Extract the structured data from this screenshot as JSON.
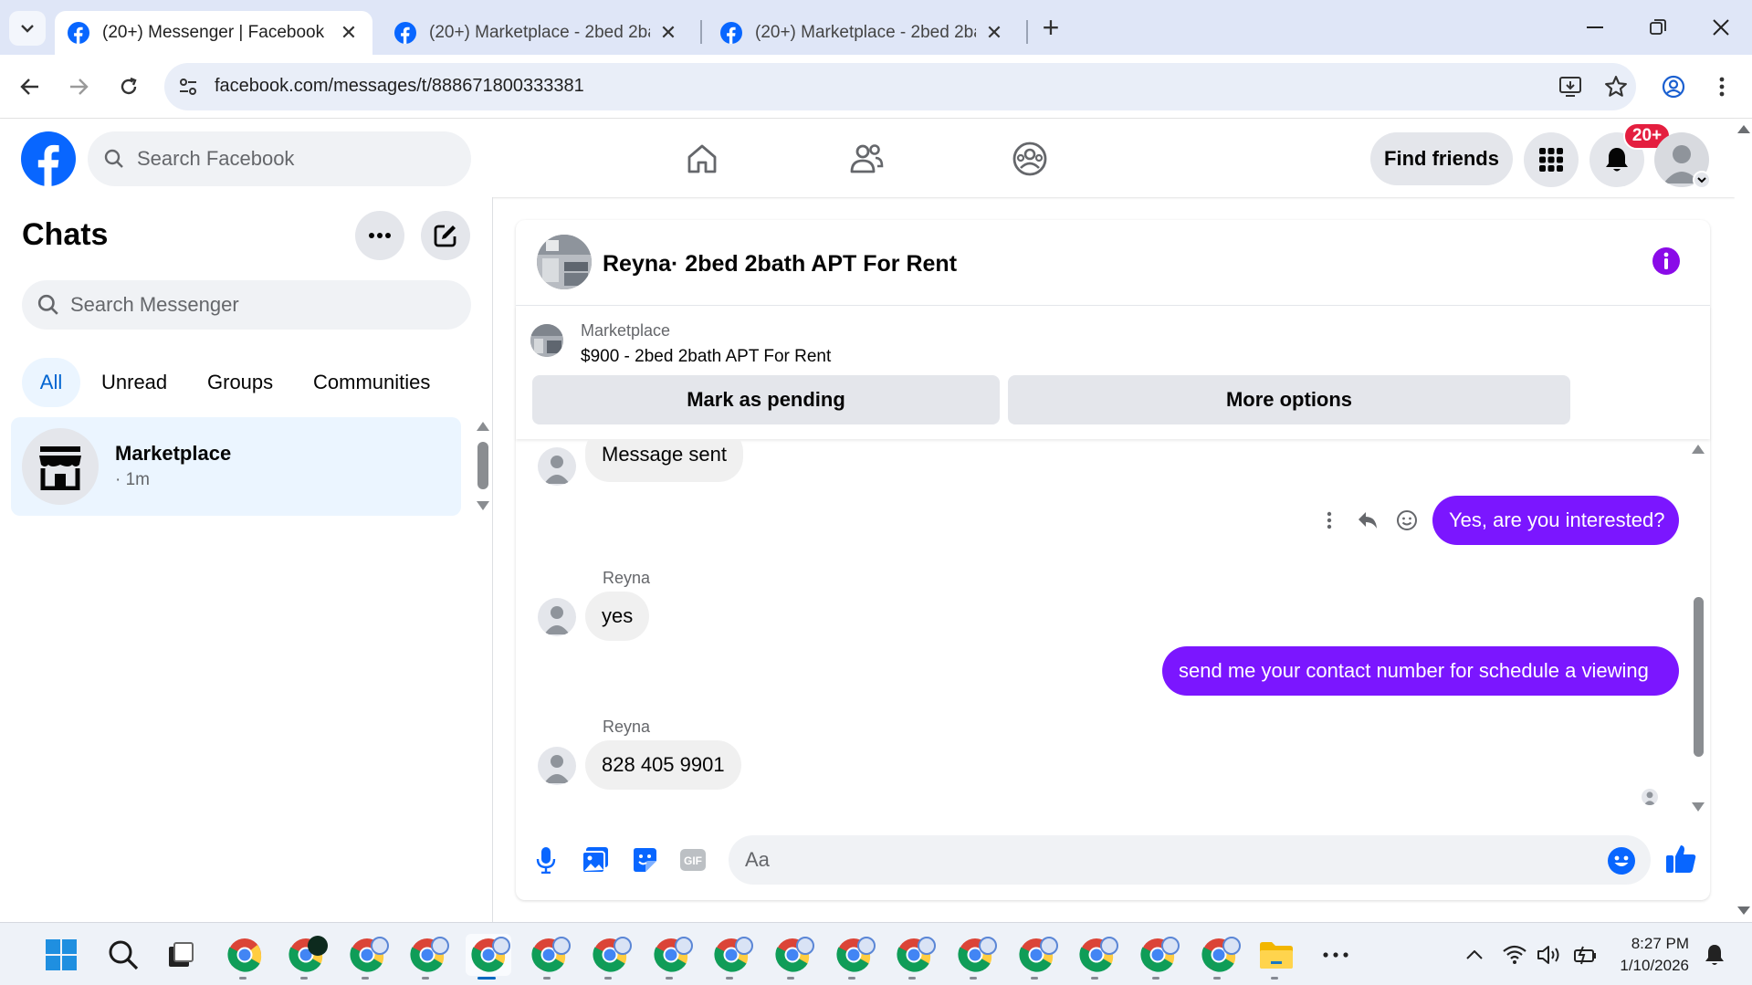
{
  "browser": {
    "tabs": [
      {
        "title": "(20+) Messenger | Facebook",
        "active": true
      },
      {
        "title": "(20+) Marketplace - 2bed 2bath",
        "active": false
      },
      {
        "title": "(20+) Marketplace - 2bed 2bath",
        "active": false
      }
    ],
    "url": "facebook.com/messages/t/888671800333381"
  },
  "fb_header": {
    "search_placeholder": "Search Facebook",
    "find_friends": "Find friends",
    "notifications_badge": "20+"
  },
  "chats_panel": {
    "title": "Chats",
    "search_placeholder": "Search Messenger",
    "filters": [
      "All",
      "Unread",
      "Groups",
      "Communities"
    ],
    "active_filter": "All",
    "items": [
      {
        "name": "Marketplace",
        "time": "· 1m"
      }
    ]
  },
  "conversation": {
    "title": "Reyna· 2bed 2bath APT For Rent",
    "listing": {
      "label": "Marketplace",
      "title": "$900 - 2bed 2bath APT For Rent",
      "pending_button": "Mark as pending",
      "more_button": "More options"
    },
    "messages": [
      {
        "from": "them",
        "text": "Message sent"
      },
      {
        "from": "me",
        "text": "Yes, are you interested?"
      },
      {
        "from": "them",
        "sender": "Reyna",
        "text": "yes"
      },
      {
        "from": "me",
        "text": "send me your contact number for schedule a viewing"
      },
      {
        "from": "them",
        "sender": "Reyna",
        "text": "828 405 9901"
      }
    ],
    "composer_placeholder": "Aa"
  },
  "taskbar": {
    "time": "8:27 PM",
    "date": "1/10/2026"
  },
  "colors": {
    "fb_blue": "#0866ff",
    "outgoing_bubble": "#7b16ff",
    "badge_red": "#e41e3f"
  }
}
